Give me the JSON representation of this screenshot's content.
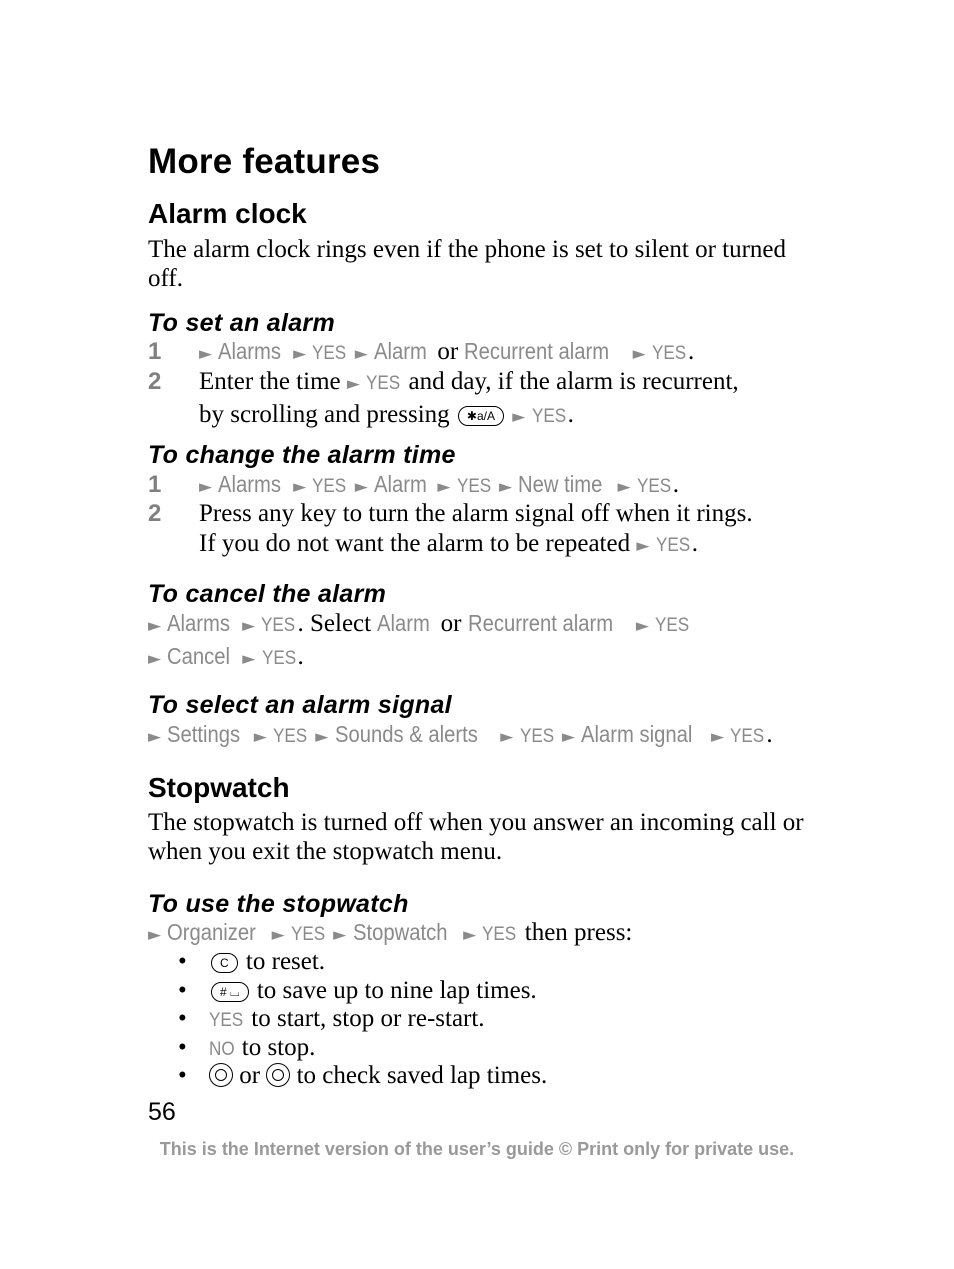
{
  "title": "More features",
  "alarm_clock": {
    "heading": "Alarm clock",
    "intro": "The alarm clock rings even if the phone is set to silent or turned off.",
    "set_alarm": {
      "heading": "To set an alarm",
      "step1_num": "1",
      "step1": [
        "Alarms",
        "YES",
        "Alarm",
        "or",
        "Recurrent alarm",
        "YES",
        "."
      ],
      "step2_num": "2",
      "step2_a": "Enter the time",
      "step2_b": "YES",
      "step2_c": "and day, if the alarm is recurrent,",
      "step2_d": "by scrolling and pressing",
      "step2_key": "✱a/A",
      "step2_e": "YES",
      "step2_f": "."
    },
    "change_time": {
      "heading": "To change the alarm time",
      "step1_num": "1",
      "step1": [
        "Alarms",
        "YES",
        "Alarm",
        "YES",
        "New time",
        "YES",
        "."
      ],
      "step2_num": "2",
      "step2_a": "Press any key to turn the alarm signal off when it rings.",
      "step2_b": "If you do not want the alarm to be repeated",
      "step2_c": "YES",
      "step2_d": "."
    },
    "cancel": {
      "heading": "To cancel the alarm",
      "items": [
        "Alarms",
        "YES",
        ". Select",
        "Alarm",
        "or",
        "Recurrent alarm",
        "YES",
        "Cancel",
        "YES",
        "."
      ]
    },
    "signal": {
      "heading": "To select an alarm signal",
      "items": [
        "Settings",
        "YES",
        "Sounds & alerts",
        "YES",
        "Alarm signal",
        "YES",
        "."
      ]
    }
  },
  "stopwatch": {
    "heading": "Stopwatch",
    "intro": "The stopwatch is turned off when you answer an incoming call or when you exit the stopwatch menu.",
    "use": {
      "heading": "To use the stopwatch",
      "path": [
        "Organizer",
        "YES",
        "Stopwatch",
        "YES",
        "then press:"
      ],
      "bullets": [
        {
          "key": "C",
          "text": "to reset."
        },
        {
          "key": "# ⌴",
          "text": "to save up to nine lap times."
        },
        {
          "key": "YES",
          "text": "to start, stop or re-start."
        },
        {
          "key": "NO",
          "text": "to stop."
        },
        {
          "or": "or",
          "text": "to check saved lap times."
        }
      ]
    }
  },
  "arrow": "►",
  "bullet": "•",
  "page_number": "56",
  "footer": "This is the Internet version of the user’s guide © Print only for private use."
}
